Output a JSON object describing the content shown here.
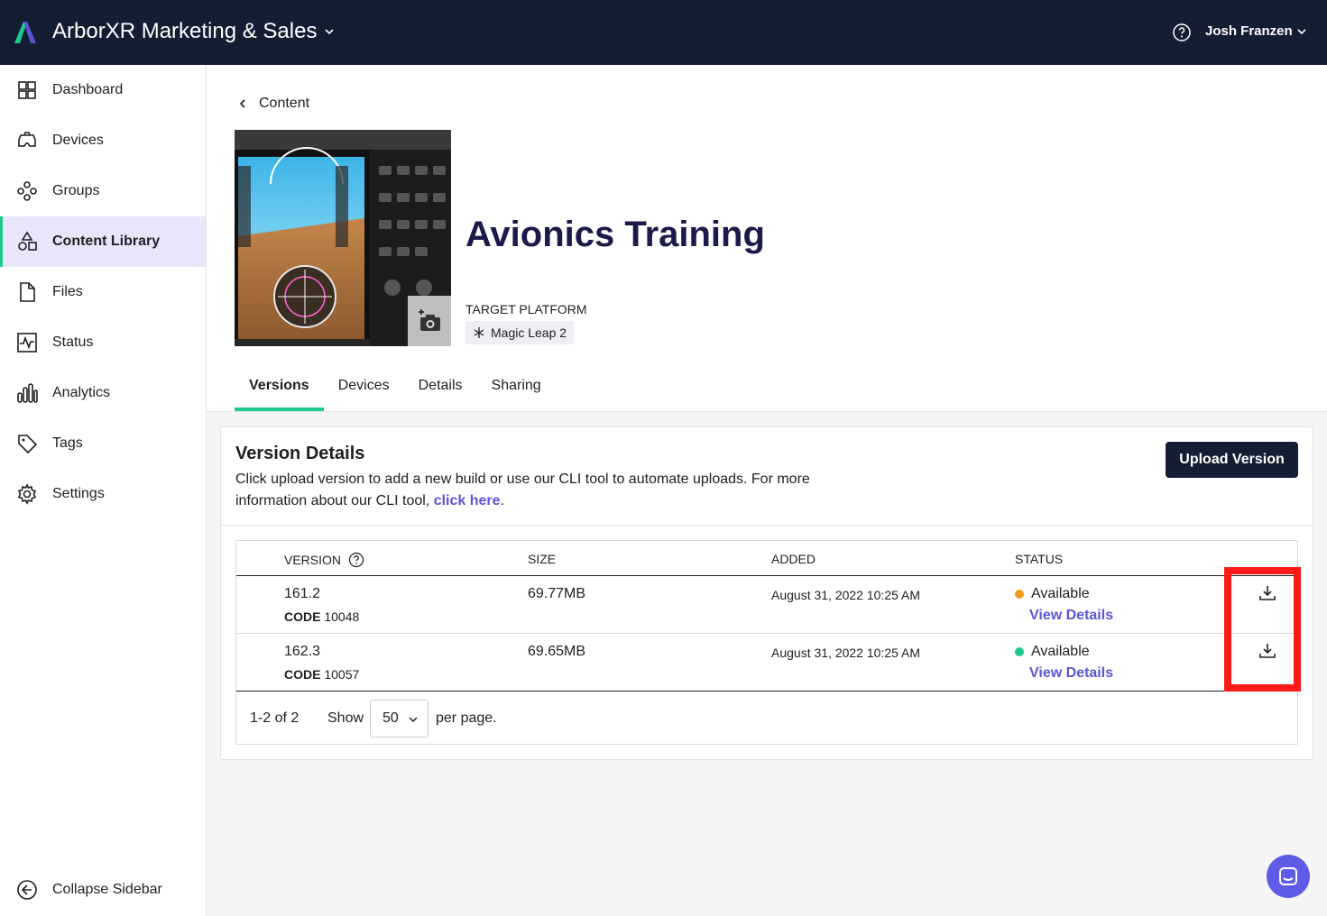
{
  "header": {
    "org_name": "ArborXR Marketing & Sales",
    "user_name": "Josh Franzen"
  },
  "sidebar": {
    "items": [
      {
        "label": "Dashboard",
        "icon": "dashboard-icon"
      },
      {
        "label": "Devices",
        "icon": "headset-icon"
      },
      {
        "label": "Groups",
        "icon": "groups-icon"
      },
      {
        "label": "Content Library",
        "icon": "shapes-icon",
        "active": true
      },
      {
        "label": "Files",
        "icon": "file-icon"
      },
      {
        "label": "Status",
        "icon": "pulse-icon"
      },
      {
        "label": "Analytics",
        "icon": "bar-chart-icon"
      },
      {
        "label": "Tags",
        "icon": "tag-icon"
      },
      {
        "label": "Settings",
        "icon": "gear-icon"
      }
    ],
    "collapse_label": "Collapse Sidebar"
  },
  "content": {
    "back_label": "Content",
    "title": "Avionics Training",
    "platform_label": "TARGET PLATFORM",
    "platform": "Magic Leap 2"
  },
  "tabs": [
    "Versions",
    "Devices",
    "Details",
    "Sharing"
  ],
  "active_tab": "Versions",
  "version_details": {
    "title": "Version Details",
    "description": "Click upload version to add a new build or use our CLI tool to automate uploads. For more information about our CLI tool, ",
    "link_text": "click here",
    "description_end": ".",
    "upload_button": "Upload Version"
  },
  "table": {
    "columns": [
      "VERSION",
      "SIZE",
      "ADDED",
      "STATUS"
    ],
    "code_label": "CODE",
    "rows": [
      {
        "version": "161.2",
        "code": "10048",
        "size": "69.77MB",
        "added": "August 31, 2022 10:25 AM",
        "status": "Available",
        "status_color": "#f29a1f",
        "details": "View Details"
      },
      {
        "version": "162.3",
        "code": "10057",
        "size": "69.65MB",
        "added": "August 31, 2022 10:25 AM",
        "status": "Available",
        "status_color": "#1ec98c",
        "details": "View Details"
      }
    ]
  },
  "pagination": {
    "range": "1-2 of 2",
    "show_label": "Show",
    "per_page": "50",
    "per_page_label": "per page."
  },
  "colors": {
    "topbar": "#141e33",
    "accent": "#1ec98c",
    "link": "#5b55d6",
    "highlight": "#ff1a1a"
  }
}
